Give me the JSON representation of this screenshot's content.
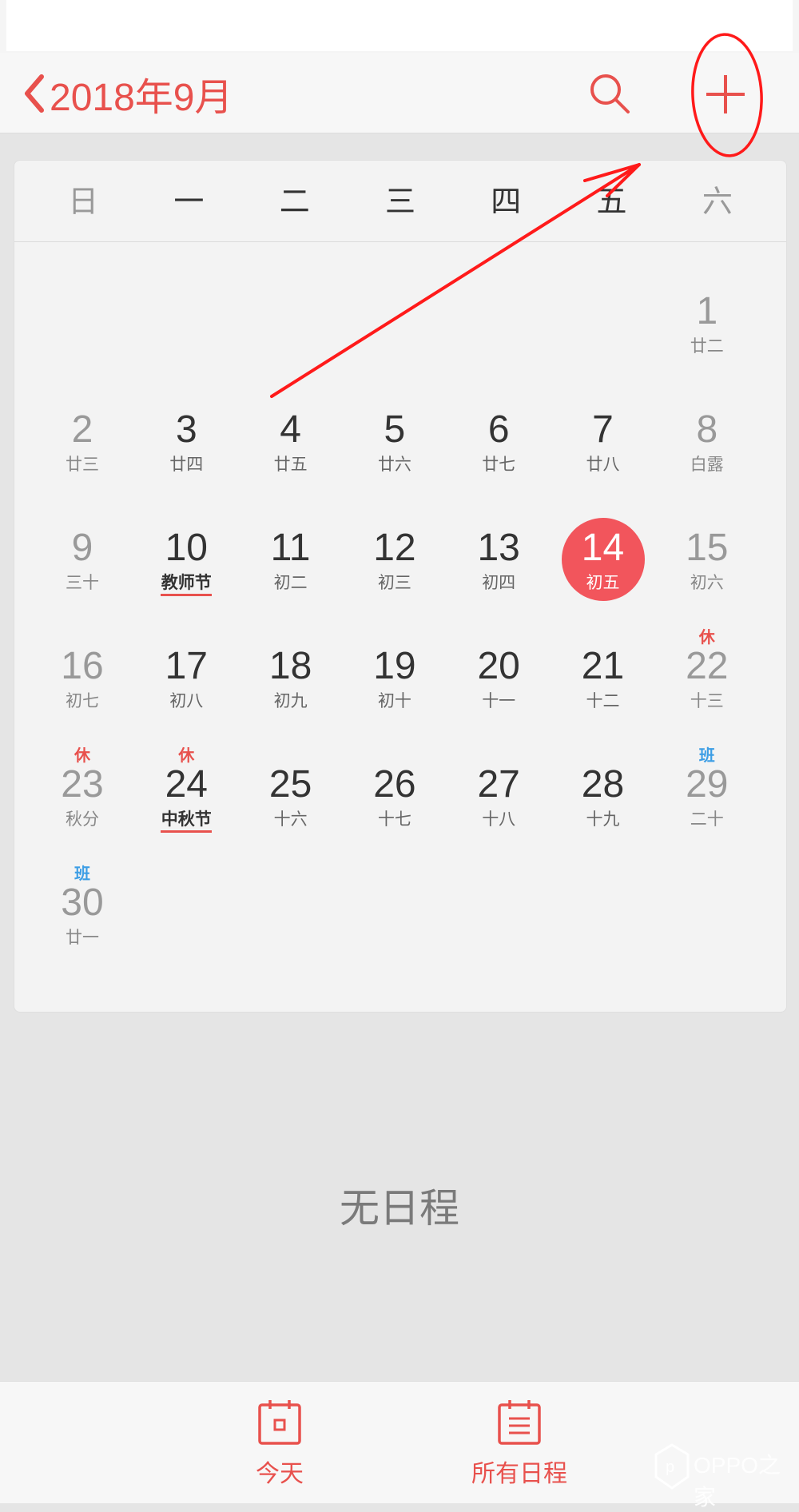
{
  "header": {
    "title": "2018年9月",
    "back_icon": "chevron-left-icon",
    "search_icon": "search-icon",
    "add_icon": "plus-icon"
  },
  "weekdays": [
    "日",
    "一",
    "二",
    "三",
    "四",
    "五",
    "六"
  ],
  "days": [
    {
      "day": "1",
      "lunar": "廿二"
    },
    {
      "day": "2",
      "lunar": "廿三"
    },
    {
      "day": "3",
      "lunar": "廿四"
    },
    {
      "day": "4",
      "lunar": "廿五"
    },
    {
      "day": "5",
      "lunar": "廿六"
    },
    {
      "day": "6",
      "lunar": "廿七"
    },
    {
      "day": "7",
      "lunar": "廿八"
    },
    {
      "day": "8",
      "lunar": "白露"
    },
    {
      "day": "9",
      "lunar": "三十"
    },
    {
      "day": "10",
      "lunar": "教师节",
      "holiday": true
    },
    {
      "day": "11",
      "lunar": "初二"
    },
    {
      "day": "12",
      "lunar": "初三"
    },
    {
      "day": "13",
      "lunar": "初四"
    },
    {
      "day": "14",
      "lunar": "初五",
      "today": true
    },
    {
      "day": "15",
      "lunar": "初六"
    },
    {
      "day": "16",
      "lunar": "初七"
    },
    {
      "day": "17",
      "lunar": "初八"
    },
    {
      "day": "18",
      "lunar": "初九"
    },
    {
      "day": "19",
      "lunar": "初十"
    },
    {
      "day": "20",
      "lunar": "十一"
    },
    {
      "day": "21",
      "lunar": "十二"
    },
    {
      "day": "22",
      "lunar": "十三",
      "badge": "休"
    },
    {
      "day": "23",
      "lunar": "秋分",
      "badge": "休"
    },
    {
      "day": "24",
      "lunar": "中秋节",
      "badge": "休",
      "holiday": true
    },
    {
      "day": "25",
      "lunar": "十六"
    },
    {
      "day": "26",
      "lunar": "十七"
    },
    {
      "day": "27",
      "lunar": "十八"
    },
    {
      "day": "28",
      "lunar": "十九"
    },
    {
      "day": "29",
      "lunar": "二十",
      "badge": "班"
    },
    {
      "day": "30",
      "lunar": "廿一",
      "badge": "班"
    }
  ],
  "first_weekday_index": 6,
  "badge_colors": {
    "休": "#e8514d",
    "班": "#3d9ee5"
  },
  "empty_state": "无日程",
  "tabs": [
    {
      "label": "今天",
      "icon": "calendar-today-icon"
    },
    {
      "label": "所有日程",
      "icon": "calendar-list-icon"
    }
  ],
  "watermark": {
    "text": "OPPO之家"
  },
  "colors": {
    "accent": "#e8514d",
    "today_circle": "#f2555c",
    "rest_badge": "#e8514d",
    "work_badge": "#3d9ee5"
  }
}
